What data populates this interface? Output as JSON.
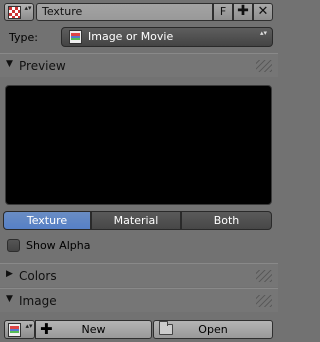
{
  "header": {
    "name_value": "Texture",
    "fake_user_label": "F",
    "add_label": "✚",
    "unlink_label": "✕",
    "updown_glyph": "▴▾",
    "texture_icon": "checker-texture-icon"
  },
  "type_row": {
    "label": "Type:",
    "selected_value": "Image or Movie",
    "arrows_glyph": "▴▾",
    "icon": "image-icon"
  },
  "panels": {
    "preview": {
      "title": "Preview",
      "expanded": true,
      "triangle": "▼"
    },
    "colors": {
      "title": "Colors",
      "expanded": false,
      "triangle": "▶"
    },
    "image": {
      "title": "Image",
      "expanded": true,
      "triangle": "▼"
    }
  },
  "preview_tabs": [
    {
      "label": "Texture",
      "active": true
    },
    {
      "label": "Material",
      "active": false
    },
    {
      "label": "Both",
      "active": false
    }
  ],
  "show_alpha": {
    "label": "Show Alpha",
    "checked": false
  },
  "image_row": {
    "new_label": "New",
    "open_label": "Open",
    "plus_glyph": "✚",
    "updown_glyph": "▴▾"
  },
  "colors": {
    "background": "#727272",
    "active_tab": "#5680c6",
    "preview_bg": "#000000",
    "select_bg": "#4a4a4a"
  }
}
